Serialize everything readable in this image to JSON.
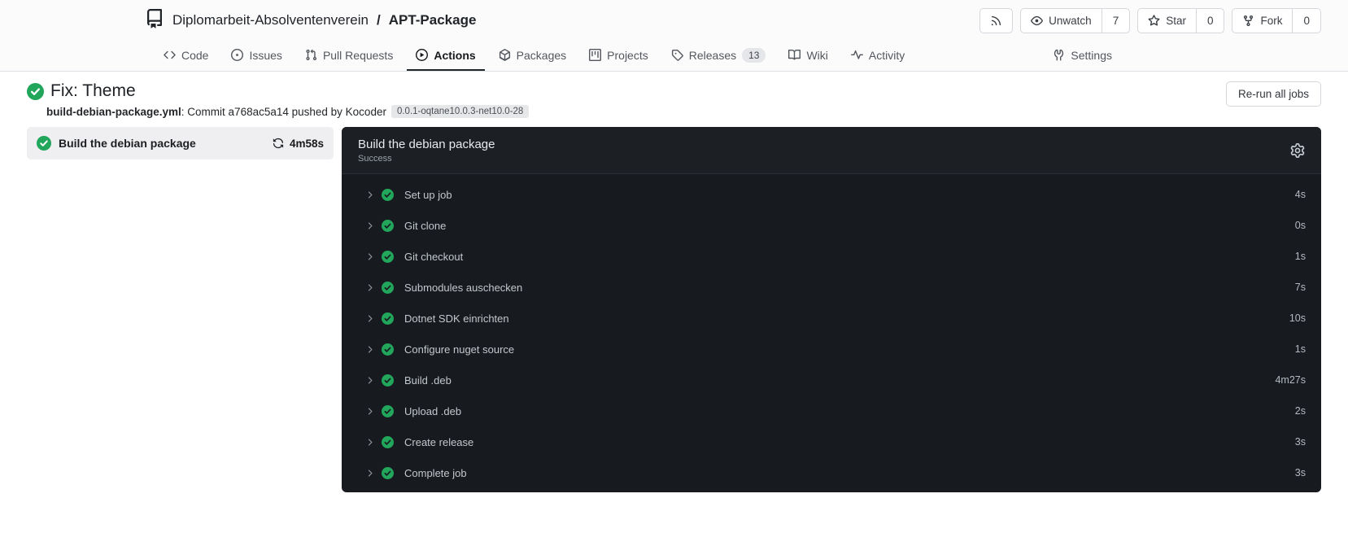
{
  "header": {
    "repo_owner": "Diplomarbeit-Absolventenverein",
    "repo_separator": "/",
    "repo_name": "APT-Package",
    "actions": {
      "unwatch_label": "Unwatch",
      "unwatch_count": "7",
      "star_label": "Star",
      "star_count": "0",
      "fork_label": "Fork",
      "fork_count": "0"
    }
  },
  "nav": {
    "tabs": [
      {
        "label": "Code"
      },
      {
        "label": "Issues"
      },
      {
        "label": "Pull Requests"
      },
      {
        "label": "Actions"
      },
      {
        "label": "Packages"
      },
      {
        "label": "Projects"
      },
      {
        "label": "Releases",
        "badge": "13"
      },
      {
        "label": "Wiki"
      },
      {
        "label": "Activity"
      }
    ],
    "settings_label": "Settings"
  },
  "run": {
    "title": "Fix: Theme",
    "workflow_file": "build-debian-package.yml",
    "commit_text": ": Commit a768ac5a14 pushed by Kocoder",
    "ref_badge": "0.0.1-oqtane10.0.3-net10.0-28",
    "rerun_button_label": "Re-run all jobs"
  },
  "job": {
    "name": "Build the debian package",
    "duration": "4m58s"
  },
  "log_panel": {
    "title": "Build the debian package",
    "status": "Success"
  },
  "steps": [
    {
      "name": "Set up job",
      "duration": "4s"
    },
    {
      "name": "Git clone",
      "duration": "0s"
    },
    {
      "name": "Git checkout",
      "duration": "1s"
    },
    {
      "name": "Submodules auschecken",
      "duration": "7s"
    },
    {
      "name": "Dotnet SDK einrichten",
      "duration": "10s"
    },
    {
      "name": "Configure nuget source",
      "duration": "1s"
    },
    {
      "name": "Build .deb",
      "duration": "4m27s"
    },
    {
      "name": "Upload .deb",
      "duration": "2s"
    },
    {
      "name": "Create release",
      "duration": "3s"
    },
    {
      "name": "Complete job",
      "duration": "3s"
    }
  ],
  "colors": {
    "success_green": "#21a65b",
    "panel_bg": "#171a1f",
    "panel_header_bg": "#1c1f24",
    "selected_job_bg": "#efeff1",
    "active_tab_underline": "#212529"
  }
}
